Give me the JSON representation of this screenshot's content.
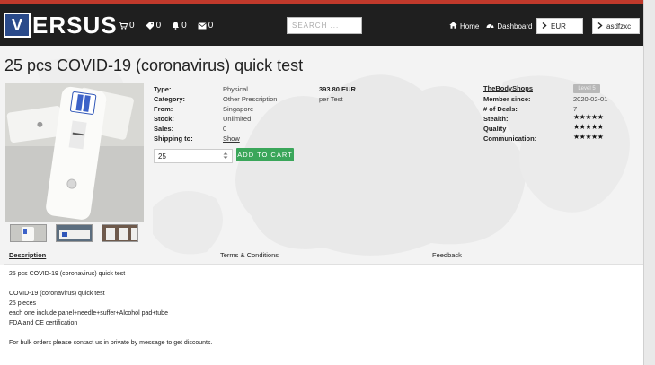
{
  "brand": {
    "logo_letter": "V",
    "logo_text": "ERSUS"
  },
  "nav": {
    "cart_count": "0",
    "tags_count": "0",
    "notifications_count": "0",
    "messages_count": "0",
    "search_placeholder": "SEARCH ...",
    "home_label": "Home",
    "dashboard_label": "Dashboard",
    "currency": "EUR",
    "username": "asdfzxc"
  },
  "product": {
    "title": "25 pcs COVID-19 (coronavirus) quick test",
    "details": [
      {
        "label": "Type:",
        "value": "Physical"
      },
      {
        "label": "Category:",
        "value": "Other Prescription"
      },
      {
        "label": "From:",
        "value": "Singapore"
      },
      {
        "label": "Stock:",
        "value": "Unlimited"
      },
      {
        "label": "Sales:",
        "value": "0"
      },
      {
        "label": "Shipping to:",
        "value": "Show"
      }
    ],
    "price": "393.80 EUR",
    "price_unit": "per Test",
    "quantity": "25",
    "add_to_cart": "ADD TO CART"
  },
  "seller": {
    "name": "TheBodyShops",
    "level_badge": "Level 5",
    "member_since_label": "Member since:",
    "member_since": "2020-02-01",
    "deals_label": "# of Deals:",
    "deals": "7",
    "stealth_label": "Stealth:",
    "quality_label": "Quality",
    "communication_label": "Communication:",
    "stars": "★★★★★",
    "ratings": {
      "stealth": 5,
      "quality": 5,
      "communication": 5
    }
  },
  "tabs": {
    "description": "Description",
    "terms": "Terms & Conditions",
    "feedback": "Feedback"
  },
  "description": {
    "line1": "25 pcs COVID-19 (coronavirus) quick test",
    "line2": "COVID-19 (coronavirus) quick test",
    "line3": "25 pieces",
    "line4": "each one include panel+needle+suffer+Alcohol pad+tube",
    "line5": "FDA and CE certification",
    "line6": "For bulk orders please contact us in private by message to get discounts."
  },
  "colors": {
    "navbar": "#1f1f1f",
    "accent_top": "#c0392b",
    "add_to_cart": "#3aa65a"
  }
}
